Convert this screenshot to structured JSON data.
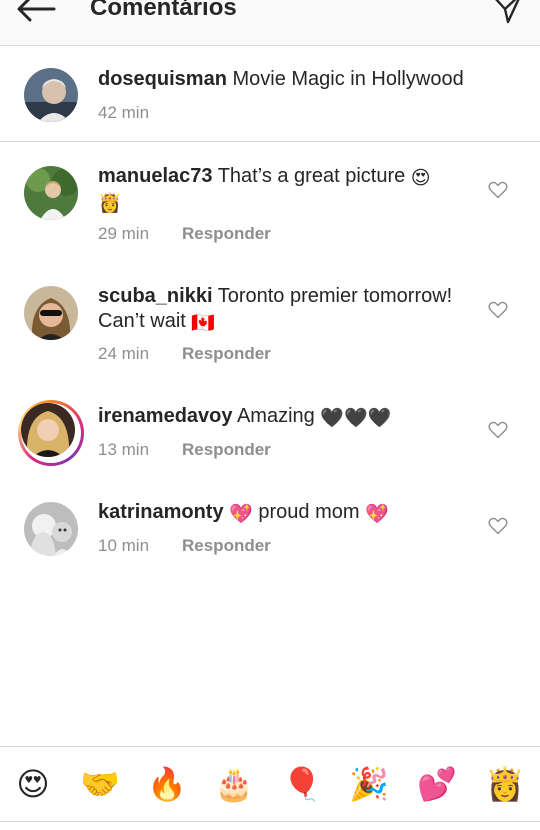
{
  "header": {
    "title": "Comentários"
  },
  "caption": {
    "username": "dosequisman",
    "text": "Movie Magic in Hollywood",
    "time": "42 min"
  },
  "comments": [
    {
      "username": "manuelac73",
      "text": "That’s a great picture",
      "emoji": "😍",
      "line2": "👸",
      "time": "29 min",
      "reply": "Responder"
    },
    {
      "username": "scuba_nikki",
      "text": "Toronto premier tomorrow!",
      "line2": "Can’t wait",
      "emoji": "🇨🇦",
      "time": "24 min",
      "reply": "Responder"
    },
    {
      "username": "irenamedavoy",
      "text": "Amazing",
      "emoji": "🖤🖤🖤",
      "time": "13 min",
      "reply": "Responder"
    },
    {
      "username": "katrinamonty",
      "pre_emoji": "💖",
      "text": "proud mom",
      "emoji": "💖",
      "time": "10 min",
      "reply": "Responder"
    }
  ],
  "emoji_bar": [
    "😍",
    "🤝",
    "🔥",
    "🎂",
    "🎈",
    "🎉",
    "💕",
    "👸"
  ]
}
